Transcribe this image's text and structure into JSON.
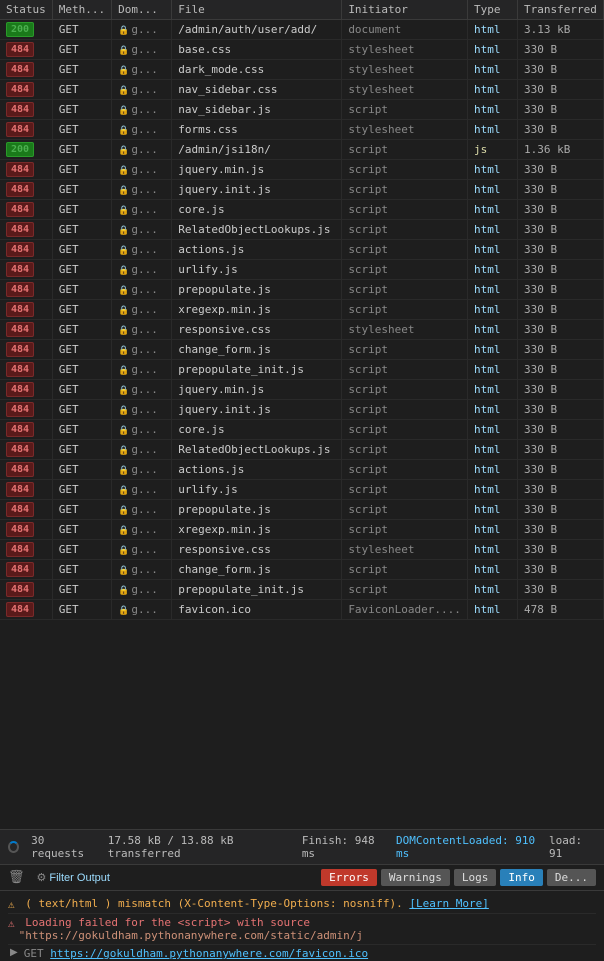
{
  "table": {
    "headers": [
      "Status",
      "Meth...",
      "Dom...",
      "File",
      "Initiator",
      "Type",
      "Transferred"
    ],
    "rows": [
      {
        "status": "200",
        "method": "GET",
        "domain": "g...",
        "file": "/admin/auth/user/add/",
        "initiator": "document",
        "type": "html",
        "transferred": "3.13 kB"
      },
      {
        "status": "484",
        "method": "GET",
        "domain": "g...",
        "file": "base.css",
        "initiator": "stylesheet",
        "type": "html",
        "transferred": "330 B"
      },
      {
        "status": "484",
        "method": "GET",
        "domain": "g...",
        "file": "dark_mode.css",
        "initiator": "stylesheet",
        "type": "html",
        "transferred": "330 B"
      },
      {
        "status": "484",
        "method": "GET",
        "domain": "g...",
        "file": "nav_sidebar.css",
        "initiator": "stylesheet",
        "type": "html",
        "transferred": "330 B"
      },
      {
        "status": "484",
        "method": "GET",
        "domain": "g...",
        "file": "nav_sidebar.js",
        "initiator": "script",
        "type": "html",
        "transferred": "330 B"
      },
      {
        "status": "484",
        "method": "GET",
        "domain": "g...",
        "file": "forms.css",
        "initiator": "stylesheet",
        "type": "html",
        "transferred": "330 B"
      },
      {
        "status": "200",
        "method": "GET",
        "domain": "g...",
        "file": "/admin/jsi18n/",
        "initiator": "script",
        "type": "js",
        "transferred": "1.36 kB"
      },
      {
        "status": "484",
        "method": "GET",
        "domain": "g...",
        "file": "jquery.min.js",
        "initiator": "script",
        "type": "html",
        "transferred": "330 B"
      },
      {
        "status": "484",
        "method": "GET",
        "domain": "g...",
        "file": "jquery.init.js",
        "initiator": "script",
        "type": "html",
        "transferred": "330 B"
      },
      {
        "status": "484",
        "method": "GET",
        "domain": "g...",
        "file": "core.js",
        "initiator": "script",
        "type": "html",
        "transferred": "330 B"
      },
      {
        "status": "484",
        "method": "GET",
        "domain": "g...",
        "file": "RelatedObjectLookups.js",
        "initiator": "script",
        "type": "html",
        "transferred": "330 B"
      },
      {
        "status": "484",
        "method": "GET",
        "domain": "g...",
        "file": "actions.js",
        "initiator": "script",
        "type": "html",
        "transferred": "330 B"
      },
      {
        "status": "484",
        "method": "GET",
        "domain": "g...",
        "file": "urlify.js",
        "initiator": "script",
        "type": "html",
        "transferred": "330 B"
      },
      {
        "status": "484",
        "method": "GET",
        "domain": "g...",
        "file": "prepopulate.js",
        "initiator": "script",
        "type": "html",
        "transferred": "330 B"
      },
      {
        "status": "484",
        "method": "GET",
        "domain": "g...",
        "file": "xregexp.min.js",
        "initiator": "script",
        "type": "html",
        "transferred": "330 B"
      },
      {
        "status": "484",
        "method": "GET",
        "domain": "g...",
        "file": "responsive.css",
        "initiator": "stylesheet",
        "type": "html",
        "transferred": "330 B"
      },
      {
        "status": "484",
        "method": "GET",
        "domain": "g...",
        "file": "change_form.js",
        "initiator": "script",
        "type": "html",
        "transferred": "330 B"
      },
      {
        "status": "484",
        "method": "GET",
        "domain": "g...",
        "file": "prepopulate_init.js",
        "initiator": "script",
        "type": "html",
        "transferred": "330 B"
      },
      {
        "status": "484",
        "method": "GET",
        "domain": "g...",
        "file": "jquery.min.js",
        "initiator": "script",
        "type": "html",
        "transferred": "330 B"
      },
      {
        "status": "484",
        "method": "GET",
        "domain": "g...",
        "file": "jquery.init.js",
        "initiator": "script",
        "type": "html",
        "transferred": "330 B"
      },
      {
        "status": "484",
        "method": "GET",
        "domain": "g...",
        "file": "core.js",
        "initiator": "script",
        "type": "html",
        "transferred": "330 B"
      },
      {
        "status": "484",
        "method": "GET",
        "domain": "g...",
        "file": "RelatedObjectLookups.js",
        "initiator": "script",
        "type": "html",
        "transferred": "330 B"
      },
      {
        "status": "484",
        "method": "GET",
        "domain": "g...",
        "file": "actions.js",
        "initiator": "script",
        "type": "html",
        "transferred": "330 B"
      },
      {
        "status": "484",
        "method": "GET",
        "domain": "g...",
        "file": "urlify.js",
        "initiator": "script",
        "type": "html",
        "transferred": "330 B"
      },
      {
        "status": "484",
        "method": "GET",
        "domain": "g...",
        "file": "prepopulate.js",
        "initiator": "script",
        "type": "html",
        "transferred": "330 B"
      },
      {
        "status": "484",
        "method": "GET",
        "domain": "g...",
        "file": "xregexp.min.js",
        "initiator": "script",
        "type": "html",
        "transferred": "330 B"
      },
      {
        "status": "484",
        "method": "GET",
        "domain": "g...",
        "file": "responsive.css",
        "initiator": "stylesheet",
        "type": "html",
        "transferred": "330 B"
      },
      {
        "status": "484",
        "method": "GET",
        "domain": "g...",
        "file": "change_form.js",
        "initiator": "script",
        "type": "html",
        "transferred": "330 B"
      },
      {
        "status": "484",
        "method": "GET",
        "domain": "g...",
        "file": "prepopulate_init.js",
        "initiator": "script",
        "type": "html",
        "transferred": "330 B"
      },
      {
        "status": "484",
        "method": "GET",
        "domain": "g...",
        "file": "favicon.ico",
        "initiator": "FaviconLoader....",
        "type": "html",
        "transferred": "478 B"
      }
    ]
  },
  "statusBar": {
    "requests": "30 requests",
    "transferred": "17.58 kB / 13.88 kB transferred",
    "finish": "Finish: 948 ms",
    "domContentLoaded": "DOMContentLoaded: 910 ms",
    "load": "load: 91"
  },
  "filterBar": {
    "filterLabel": "Filter Output",
    "tabs": {
      "errors": "Errors",
      "warnings": "Warnings",
      "logs": "Logs",
      "info": "Info",
      "debug": "De..."
    }
  },
  "console": {
    "lines": [
      {
        "type": "warning",
        "icon": "⚠",
        "text": "( text/html ) mismatch (X-Content-Type-Options: nosniff). [Learn More]"
      },
      {
        "type": "error",
        "icon": "⚠",
        "text": "Loading failed for the <script> with source \"https://gokuldham.pythonanywhere.com/static/admin/j"
      },
      {
        "type": "get",
        "icon": "►",
        "text": "GET https://gokuldham.pythonanywhere.com/favicon.ico"
      }
    ]
  }
}
